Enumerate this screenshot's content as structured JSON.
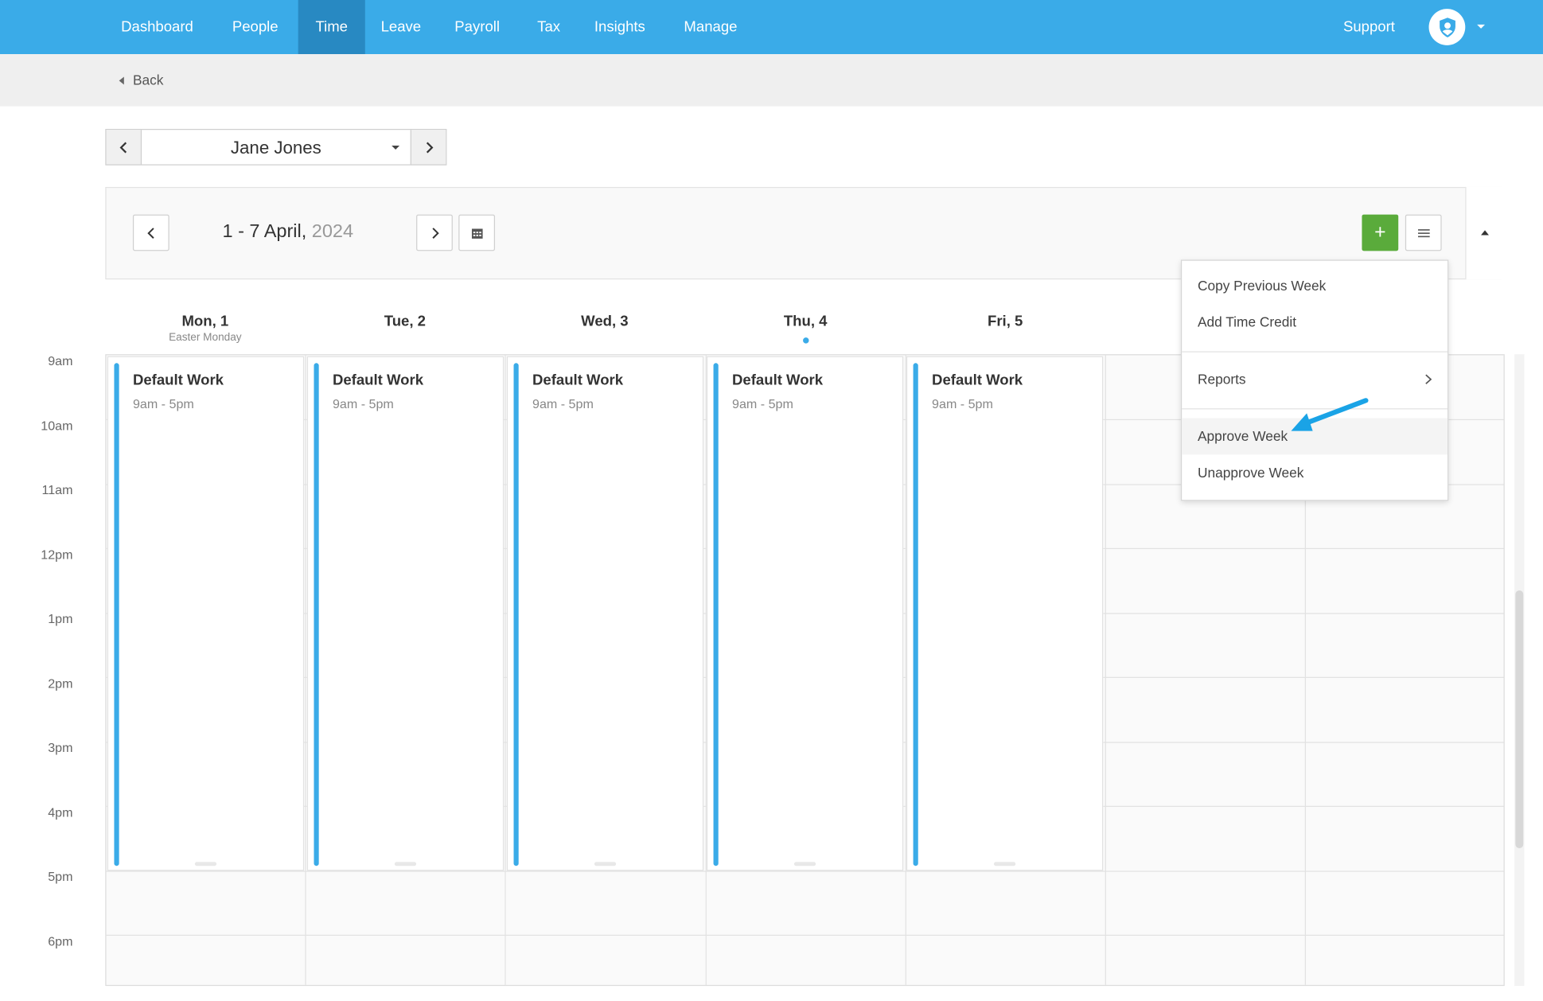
{
  "topnav": {
    "items": [
      "Dashboard",
      "People",
      "Time",
      "Leave",
      "Payroll",
      "Tax",
      "Insights",
      "Manage"
    ],
    "active": "Time",
    "support": "Support"
  },
  "backbar": {
    "back_label": "Back"
  },
  "employee": {
    "name": "Jane Jones"
  },
  "week": {
    "range": "1 - 7 April,",
    "year": "2024"
  },
  "add_label": "+",
  "days": [
    {
      "label": "Mon, 1",
      "sub": "Easter Monday"
    },
    {
      "label": "Tue, 2",
      "sub": ""
    },
    {
      "label": "Wed, 3",
      "sub": ""
    },
    {
      "label": "Thu, 4",
      "sub": ""
    },
    {
      "label": "Fri, 5",
      "sub": ""
    }
  ],
  "times": [
    "9am",
    "10am",
    "11am",
    "12pm",
    "1pm",
    "2pm",
    "3pm",
    "4pm",
    "5pm",
    "6pm"
  ],
  "events": [
    {
      "title": "Default Work",
      "time": "9am - 5pm"
    },
    {
      "title": "Default Work",
      "time": "9am - 5pm"
    },
    {
      "title": "Default Work",
      "time": "9am - 5pm"
    },
    {
      "title": "Default Work",
      "time": "9am - 5pm"
    },
    {
      "title": "Default Work",
      "time": "9am - 5pm"
    }
  ],
  "menu": {
    "copy_previous_week": "Copy Previous Week",
    "add_time_credit": "Add Time Credit",
    "reports": "Reports",
    "approve_week": "Approve Week",
    "unapprove_week": "Unapprove Week"
  },
  "colors": {
    "brand": "#3aabe8",
    "nav_active": "#2889c2",
    "add_button": "#5aab3b",
    "annotation_arrow": "#1aa3e6"
  },
  "icons": {
    "avatar": "user-shield-icon",
    "calendar": "calendar-icon",
    "menu": "hamburger-icon",
    "annotation": "arrow-pointer"
  }
}
